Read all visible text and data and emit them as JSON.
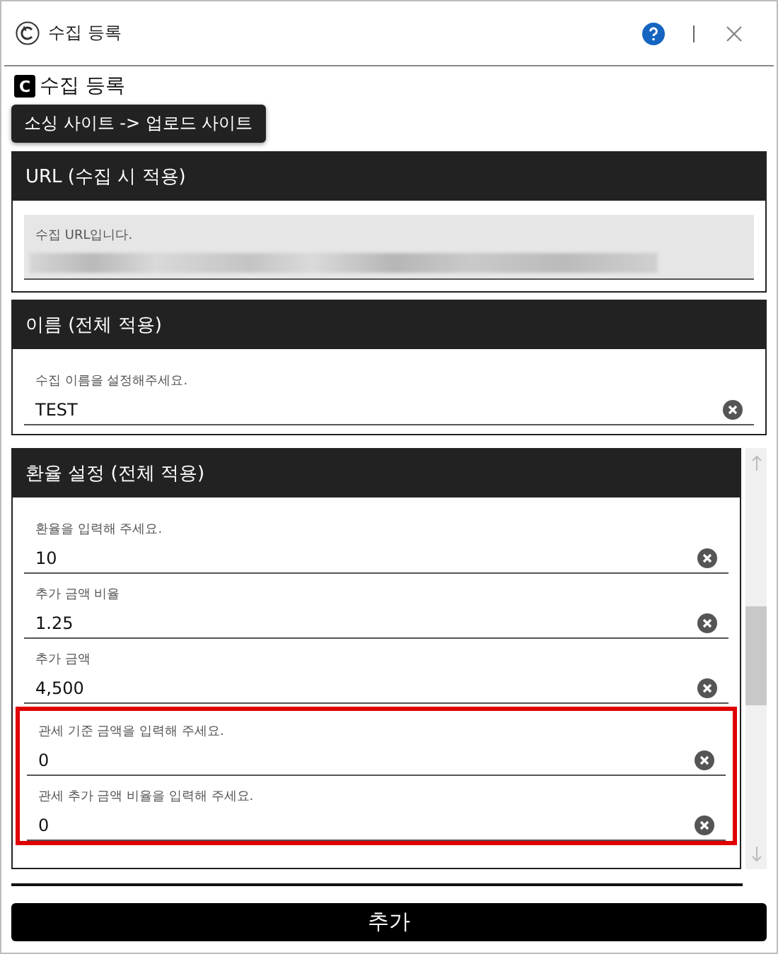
{
  "window": {
    "title": "수집 등록"
  },
  "heading": {
    "badge": "C",
    "title": "수집 등록"
  },
  "tooltip": "소싱 사이트 -> 업로드 사이트",
  "sections": [
    {
      "title": "URL (수집 시 적용)",
      "scrollable": false,
      "fields": [
        {
          "kind": "redacted",
          "label": "수집 URL입니다.",
          "highlighted": false
        }
      ]
    },
    {
      "title": "이름 (전체 적용)",
      "scrollable": false,
      "fields": [
        {
          "kind": "input",
          "label": "수집 이름을 설정해주세요.",
          "value": "TEST",
          "highlighted": false
        }
      ]
    },
    {
      "title": "환율 설정 (전체 적용)",
      "scrollable": true,
      "fields": [
        {
          "kind": "input",
          "label": "환율을 입력해 주세요.",
          "value": "10",
          "highlighted": false
        },
        {
          "kind": "input",
          "label": "추가 금액 비율",
          "value": "1.25",
          "highlighted": false
        },
        {
          "kind": "input",
          "label": "추가 금액",
          "value": "4,500",
          "highlighted": false
        },
        {
          "kind": "input",
          "label": "관세 기준 금액을 입력해 주세요.",
          "value": "0",
          "highlighted": true
        },
        {
          "kind": "input",
          "label": "관세 추가 금액 비율을 입력해 주세요.",
          "value": "0",
          "highlighted": true
        }
      ]
    }
  ],
  "submit": "추가"
}
